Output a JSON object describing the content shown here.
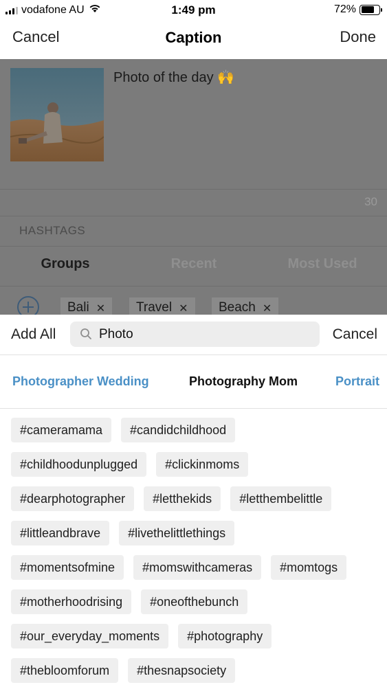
{
  "status_bar": {
    "carrier": "vodafone AU",
    "time": "1:49 pm",
    "battery": "72%",
    "battery_level": 0.72
  },
  "nav": {
    "cancel": "Cancel",
    "title": "Caption",
    "done": "Done"
  },
  "caption": {
    "text": "Photo of the day 🙌",
    "count": "30"
  },
  "hashtags": {
    "label": "HASHTAGS",
    "tabs": [
      "Groups",
      "Recent",
      "Most Used"
    ],
    "groups": [
      "Bali",
      "Travel",
      "Beach"
    ]
  },
  "search": {
    "add_all": "Add All",
    "value": "Photo",
    "cancel": "Cancel"
  },
  "categories": [
    "Photographer Wedding",
    "Photography Mom",
    "Portrait"
  ],
  "tag_rows": [
    [
      "#cameramama",
      "#candidchildhood"
    ],
    [
      "#childhoodunplugged",
      "#clickinmoms"
    ],
    [
      "#dearphotographer",
      "#letthekids",
      "#letthembelittle"
    ],
    [
      "#littleandbrave",
      "#livethelittlethings"
    ],
    [
      "#momentsofmine",
      "#momswithcameras",
      "#momtogs"
    ],
    [
      "#motherhoodrising",
      "#oneofthebunch"
    ],
    [
      "#our_everyday_moments",
      "#photography"
    ],
    [
      "#thebloomforum",
      "#thesnapsociety"
    ]
  ],
  "icons": {
    "plus": "plus-circle-icon",
    "search": "search-icon",
    "remove": "close-icon"
  }
}
